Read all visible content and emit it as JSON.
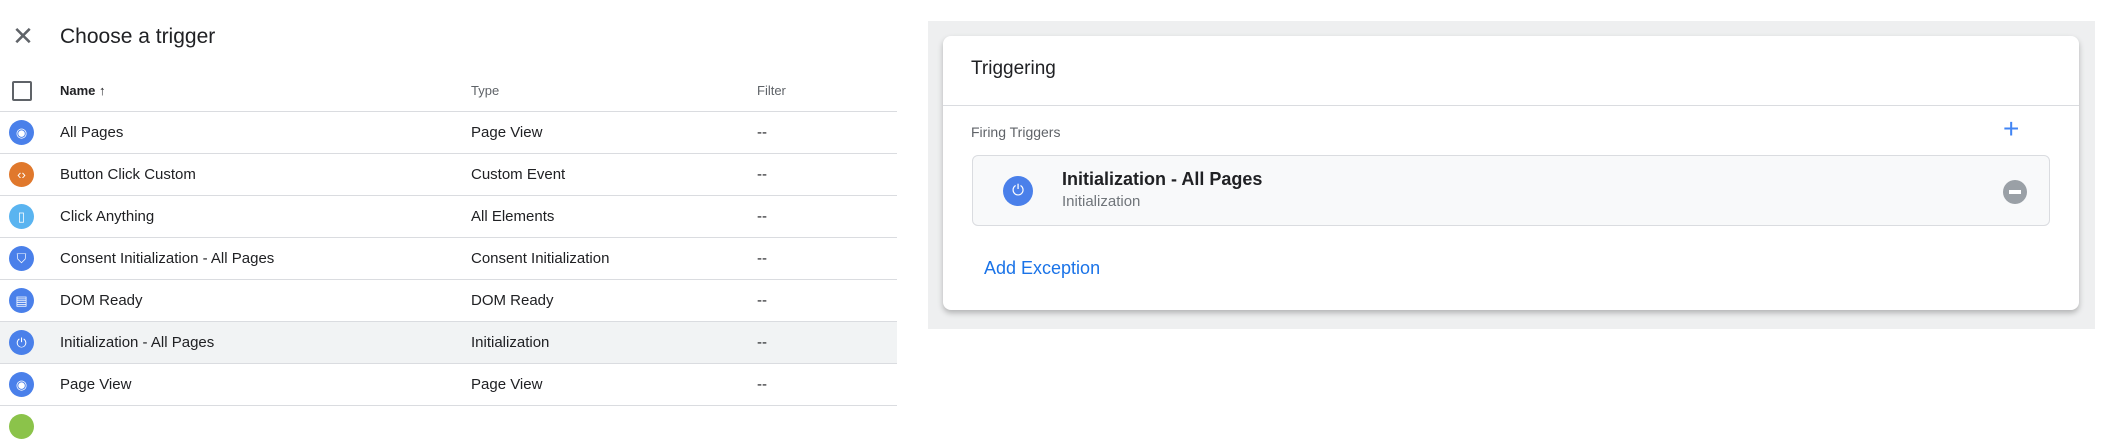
{
  "dialog": {
    "title": "Choose a trigger",
    "close_icon": "close-icon"
  },
  "table": {
    "headers": {
      "name": "Name",
      "sort_icon": "↑",
      "type": "Type",
      "filter": "Filter"
    },
    "rows": [
      {
        "name": "All Pages",
        "type": "Page View",
        "filter": "--",
        "icon": "eye-icon",
        "color": "#4a80ea"
      },
      {
        "name": "Button Click Custom",
        "type": "Custom Event",
        "filter": "--",
        "icon": "code-icon",
        "color": "#e0782c"
      },
      {
        "name": "Click Anything",
        "type": "All Elements",
        "filter": "--",
        "icon": "mouse-icon",
        "color": "#5ab4f0"
      },
      {
        "name": "Consent Initialization - All Pages",
        "type": "Consent Initialization",
        "filter": "--",
        "icon": "shield-icon",
        "color": "#4a80ea"
      },
      {
        "name": "DOM Ready",
        "type": "DOM Ready",
        "filter": "--",
        "icon": "document-icon",
        "color": "#4a80ea"
      },
      {
        "name": "Initialization - All Pages",
        "type": "Initialization",
        "filter": "--",
        "icon": "power-icon",
        "color": "#4a80ea",
        "selected": true
      },
      {
        "name": "Page View",
        "type": "Page View",
        "filter": "--",
        "icon": "eye-icon",
        "color": "#4a80ea"
      }
    ]
  },
  "triggering": {
    "title": "Triggering",
    "firing_label": "Firing Triggers",
    "add_icon": "+",
    "trigger": {
      "name": "Initialization - All Pages",
      "type": "Initialization",
      "icon": "power-icon"
    },
    "add_exception": "Add Exception"
  }
}
